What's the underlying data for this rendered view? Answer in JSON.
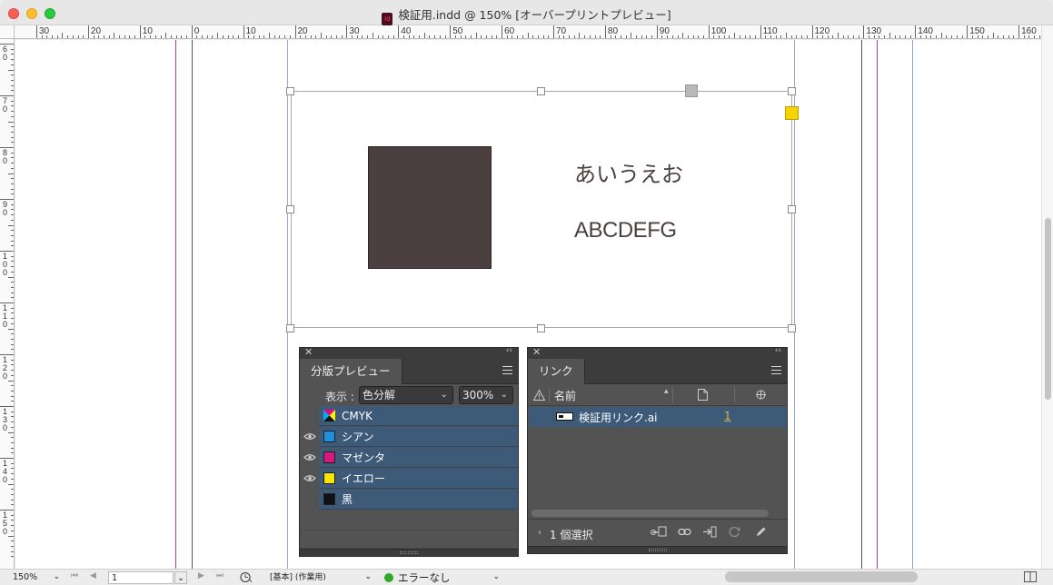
{
  "window": {
    "title": "検証用.indd @ 150% [オーバープリントプレビュー]",
    "app_icon_text": "Id"
  },
  "rulers": {
    "horizontal_labels": [
      "30",
      "20",
      "10",
      "0",
      "10",
      "20",
      "30",
      "40",
      "50",
      "60",
      "70",
      "80",
      "90",
      "100",
      "110",
      "120",
      "130",
      "140",
      "150",
      "160"
    ],
    "vertical_labels": [
      "60",
      "70",
      "80",
      "90",
      "100",
      "110",
      "120",
      "130",
      "140",
      "150"
    ]
  },
  "document": {
    "japanese_text": "あいうえお",
    "latin_text": "ABCDEFG",
    "colors": {
      "rectangle": "#4b3f3f",
      "text": "#4b3f3f",
      "magenta_guide": "#c0399a",
      "blue_guide": "#8aa6d6"
    }
  },
  "separations_panel": {
    "tab_label": "分版プレビュー",
    "view_label": "表示 :",
    "view_value": "色分解",
    "zoom_value": "300%",
    "rows": [
      {
        "name": "CMYK",
        "icon": "cmyk-icon",
        "eye": false
      },
      {
        "name": "シアン",
        "color": "#1f8fdc",
        "eye": true
      },
      {
        "name": "マゼンタ",
        "color": "#d6177e",
        "eye": true
      },
      {
        "name": "イエロー",
        "color": "#f6e500",
        "eye": true
      },
      {
        "name": "黒",
        "color": "#111111",
        "eye": false
      }
    ]
  },
  "links_panel": {
    "tab_label": "リンク",
    "col_name": "名前",
    "link_name": "検証用リンク.ai",
    "link_page": "1",
    "selection_status": "1 個選択"
  },
  "status_bar": {
    "zoom": "150%",
    "page": "1",
    "preflight_profile": "[基本] (作業用)",
    "error_status": "エラーなし",
    "status_color": "#2aa92a"
  }
}
